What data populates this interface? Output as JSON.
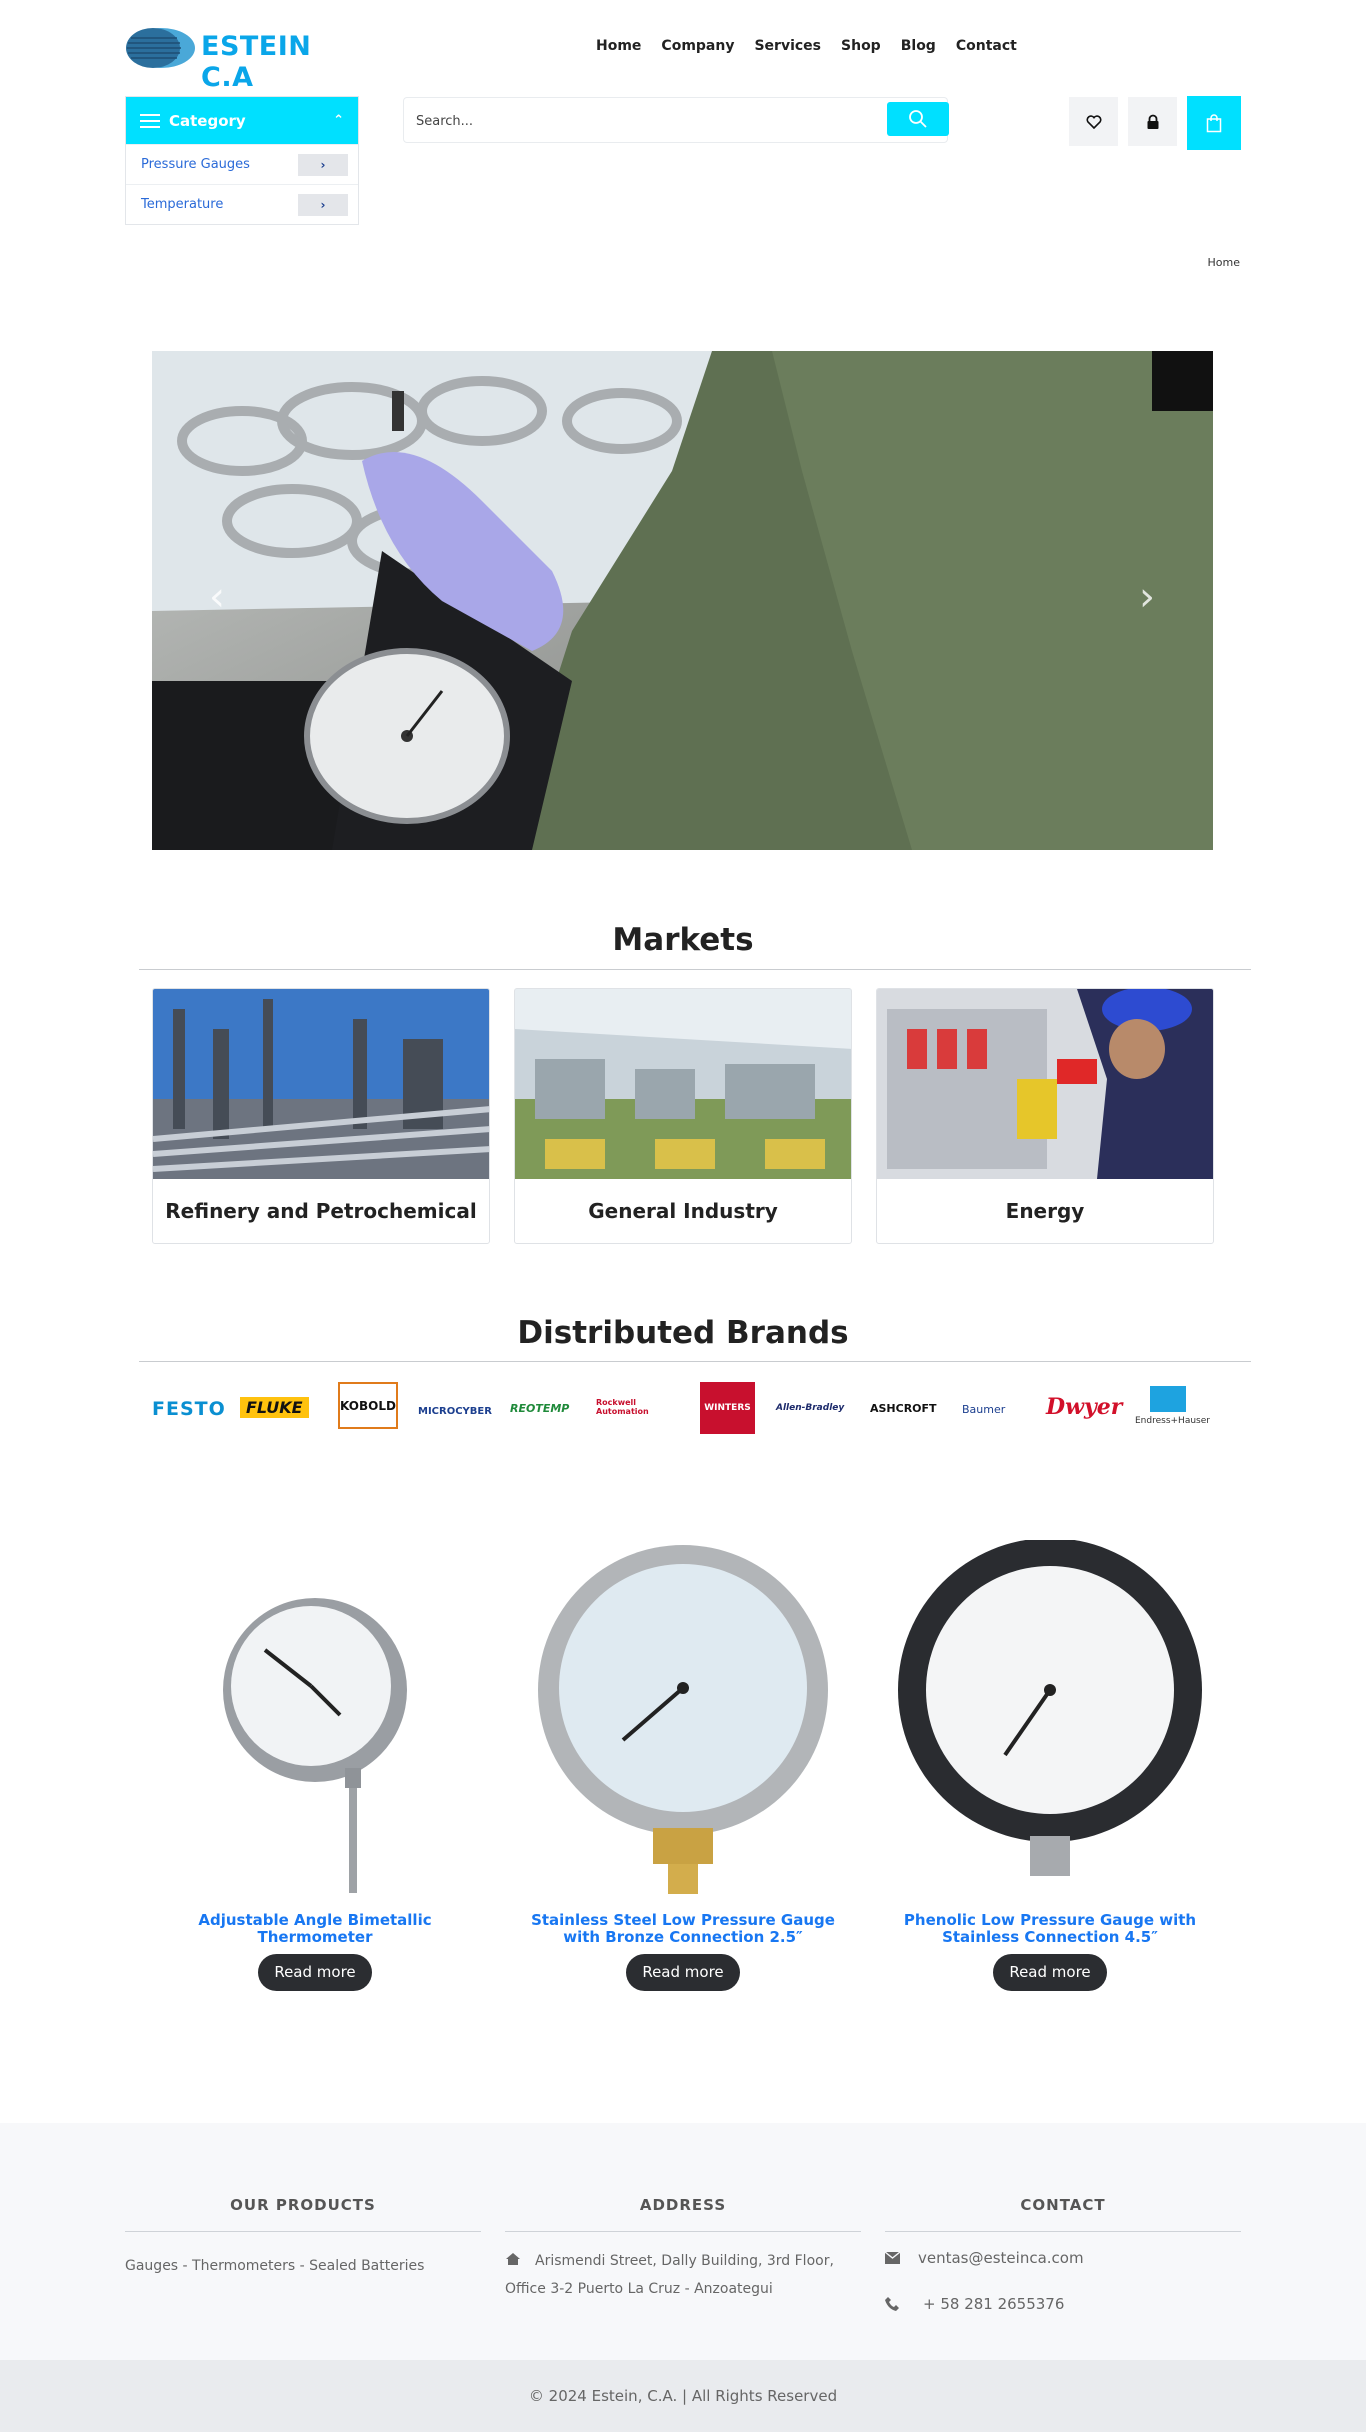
{
  "brand": {
    "name": "ESTEIN C.A",
    "accent": "#00e0ff",
    "logo_blue": "#0aa6e9"
  },
  "nav": [
    "Home",
    "Company",
    "Services",
    "Shop",
    "Blog",
    "Contact"
  ],
  "category": {
    "title": "Category",
    "items": [
      "Pressure Gauges",
      "Temperature"
    ]
  },
  "search": {
    "placeholder": "Search...",
    "icon": "search-icon"
  },
  "header_icons": [
    "heart-icon",
    "lock-icon",
    "shopping-bag-icon"
  ],
  "breadcrumb": "Home",
  "hero": {
    "prev_icon": "chevron-left-icon",
    "next_icon": "chevron-right-icon"
  },
  "markets": {
    "title": "Markets",
    "items": [
      "Refinery and Petrochemical",
      "General Industry",
      "Energy"
    ]
  },
  "brands": {
    "title": "Distributed Brands",
    "logos": [
      "FESTO",
      "FLUKE",
      "KOBOLD",
      "MICROCYBER",
      "REOTEMP",
      "Rockwell Automation",
      "WINTERS",
      "Allen-Bradley",
      "ASHCROFT",
      "Baumer",
      "Dwyer",
      "Endress+Hauser"
    ]
  },
  "products": [
    {
      "name": "Adjustable Angle Bimetallic Thermometer",
      "cta": "Read more"
    },
    {
      "name": "Stainless Steel Low Pressure Gauge with Bronze Connection 2.5″",
      "cta": "Read more"
    },
    {
      "name": "Phenolic Low Pressure Gauge with Stainless Connection 4.5″",
      "cta": "Read more"
    }
  ],
  "footer": {
    "products_title": "OUR PRODUCTS",
    "products_text": "Gauges - Thermometers - Sealed Batteries",
    "address_title": "ADDRESS",
    "address_text": "Arismendi Street, Dally Building, 3rd Floor, Office 3-2 Puerto La Cruz - Anzoategui",
    "contact_title": "CONTACT",
    "email": "ventas@esteinca.com",
    "phone": "+ 58 281 2655376",
    "copyright": "© 2024 Estein, C.A. | All Rights Reserved"
  }
}
